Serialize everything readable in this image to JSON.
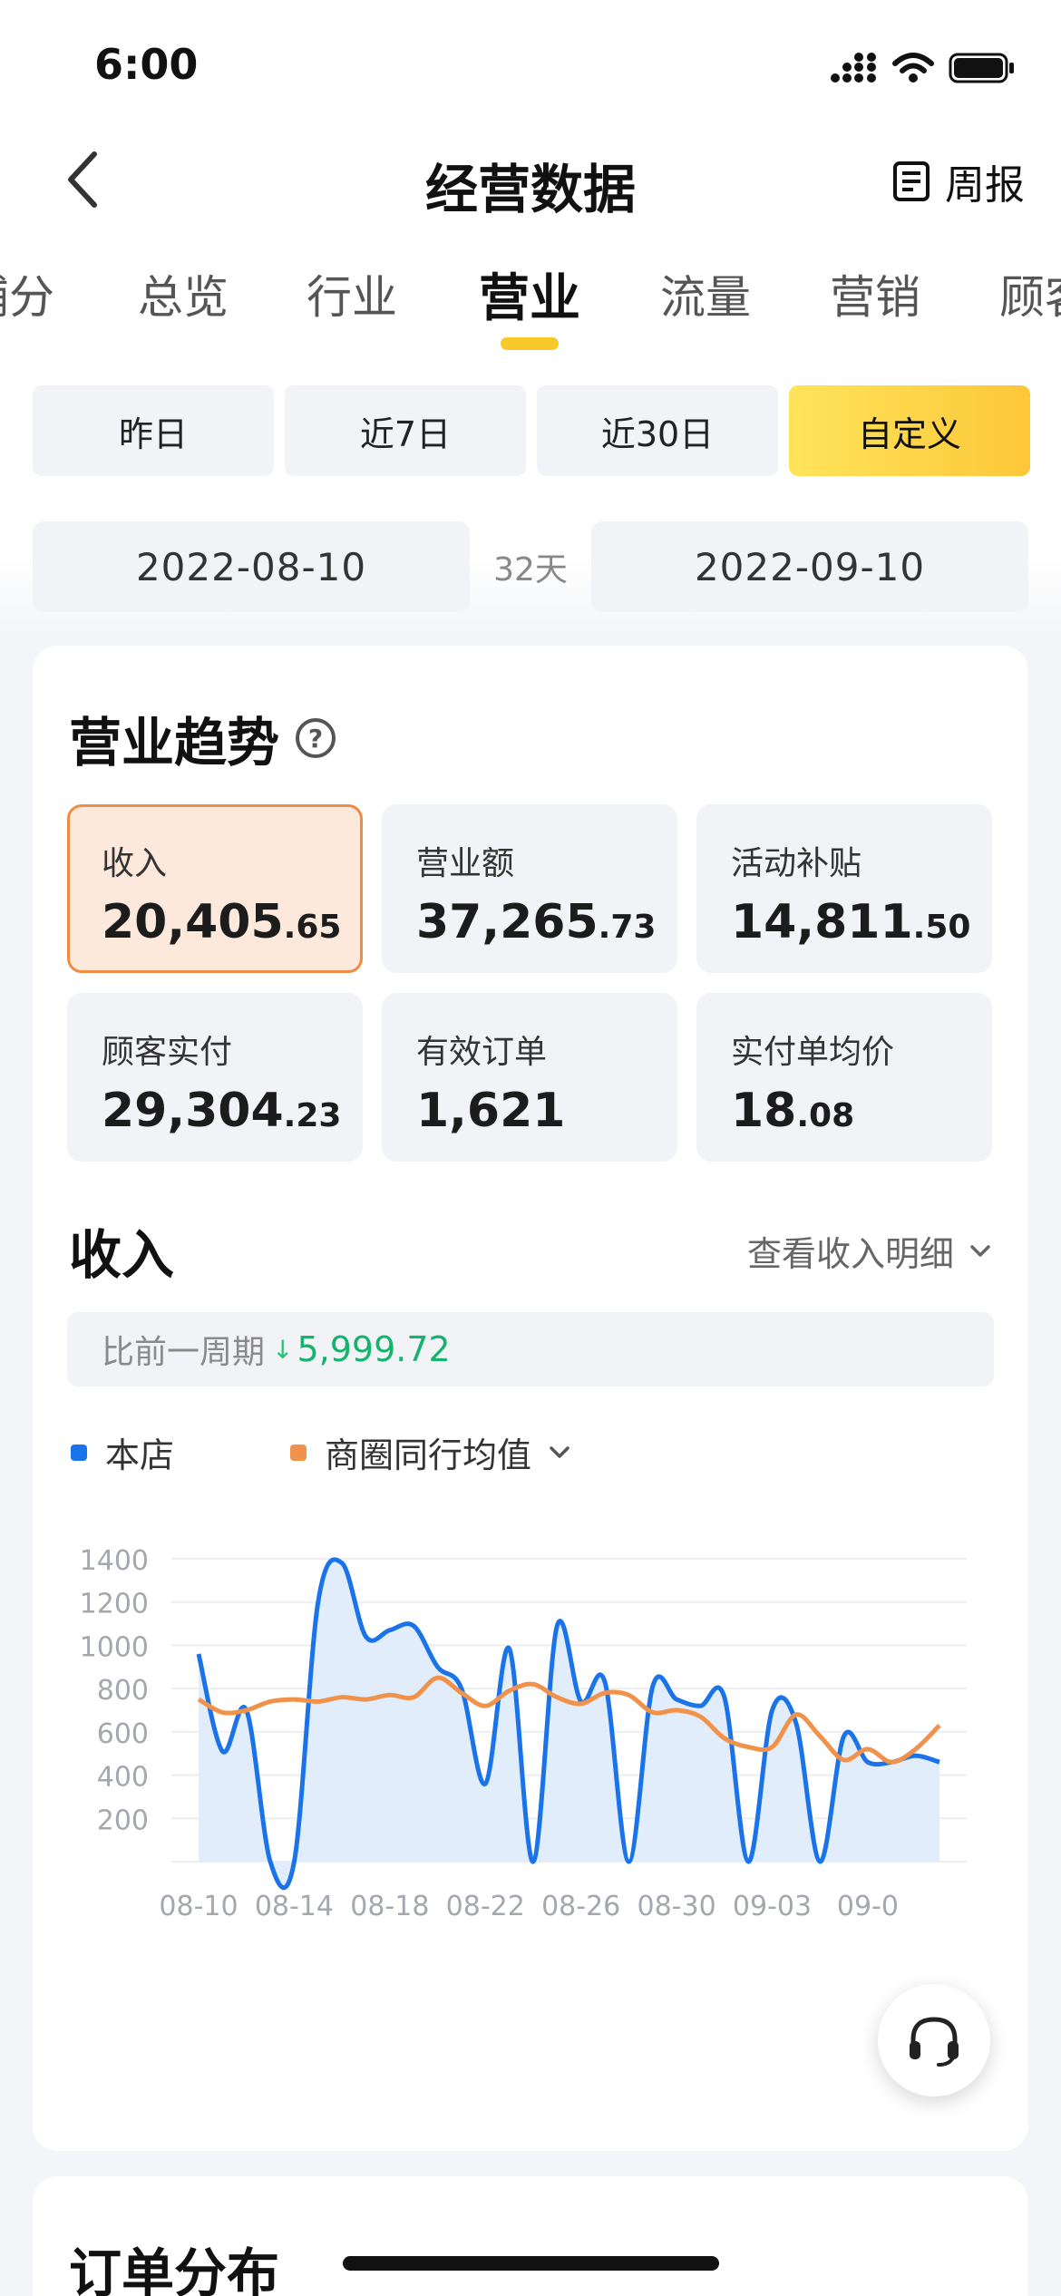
{
  "status_bar": {
    "time": "6:00"
  },
  "header": {
    "title": "经营数据",
    "weekly_label": "周报",
    "back_icon": "chevron-left-icon",
    "weekly_icon": "document-list-icon"
  },
  "tabs": [
    {
      "label": "铺分"
    },
    {
      "label": "总览"
    },
    {
      "label": "行业"
    },
    {
      "label": "营业",
      "active": true
    },
    {
      "label": "流量"
    },
    {
      "label": "营销"
    },
    {
      "label": "顾客"
    }
  ],
  "ranges": [
    {
      "label": "昨日"
    },
    {
      "label": "近7日"
    },
    {
      "label": "近30日"
    },
    {
      "label": "自定义",
      "active": true
    }
  ],
  "date_range": {
    "start": "2022-08-10",
    "days": "32天",
    "end": "2022-09-10"
  },
  "trend": {
    "title": "营业趋势",
    "metrics": [
      {
        "label": "收入",
        "int": "20,405",
        "frac": ".65",
        "active": true
      },
      {
        "label": "营业额",
        "int": "37,265",
        "frac": ".73"
      },
      {
        "label": "活动补贴",
        "int": "14,811",
        "frac": ".50"
      },
      {
        "label": "顾客实付",
        "int": "29,304",
        "frac": ".23"
      },
      {
        "label": "有效订单",
        "int": "1,621",
        "frac": ""
      },
      {
        "label": "实付单均价",
        "int": "18",
        "frac": ".08"
      }
    ]
  },
  "income": {
    "title": "收入",
    "detail_link": "查看收入明细",
    "compare_label": "比前一周期",
    "compare_value": "5,999.72",
    "compare_direction": "down"
  },
  "legend": {
    "store": "本店",
    "peer": "商圈同行均值"
  },
  "colors": {
    "store": "#1a73e8",
    "peer": "#f0924a",
    "accent": "#f8c92a",
    "down": "#16b36e"
  },
  "chart_data": {
    "type": "area",
    "x": [
      "08-10",
      "08-11",
      "08-12",
      "08-13",
      "08-14",
      "08-15",
      "08-16",
      "08-17",
      "08-18",
      "08-19",
      "08-20",
      "08-21",
      "08-22",
      "08-23",
      "08-24",
      "08-25",
      "08-26",
      "08-27",
      "08-28",
      "08-29",
      "08-30",
      "08-31",
      "09-01",
      "09-02",
      "09-03",
      "09-04",
      "09-05",
      "09-06",
      "09-07",
      "09-08",
      "09-09",
      "09-10"
    ],
    "x_tick_labels": [
      "08-10",
      "08-14",
      "08-18",
      "08-22",
      "08-26",
      "08-30",
      "09-03",
      "09-0"
    ],
    "y_ticks": [
      200,
      400,
      600,
      800,
      1000,
      1200,
      1400
    ],
    "ylim": [
      0,
      1400
    ],
    "series": [
      {
        "name": "本店",
        "type": "area",
        "values": [
          960,
          510,
          700,
          0,
          0,
          1200,
          1380,
          1040,
          1070,
          1090,
          900,
          800,
          360,
          985,
          0,
          1090,
          740,
          830,
          0,
          810,
          750,
          720,
          760,
          0,
          700,
          640,
          0,
          580,
          460,
          460,
          490,
          460
        ]
      },
      {
        "name": "商圈同行均值",
        "type": "line",
        "values": [
          750,
          690,
          700,
          740,
          750,
          740,
          760,
          750,
          770,
          760,
          850,
          780,
          720,
          790,
          820,
          760,
          730,
          780,
          770,
          690,
          700,
          670,
          570,
          530,
          530,
          680,
          580,
          470,
          520,
          460,
          520,
          630
        ]
      }
    ]
  },
  "order_section": {
    "title": "订单分布"
  }
}
